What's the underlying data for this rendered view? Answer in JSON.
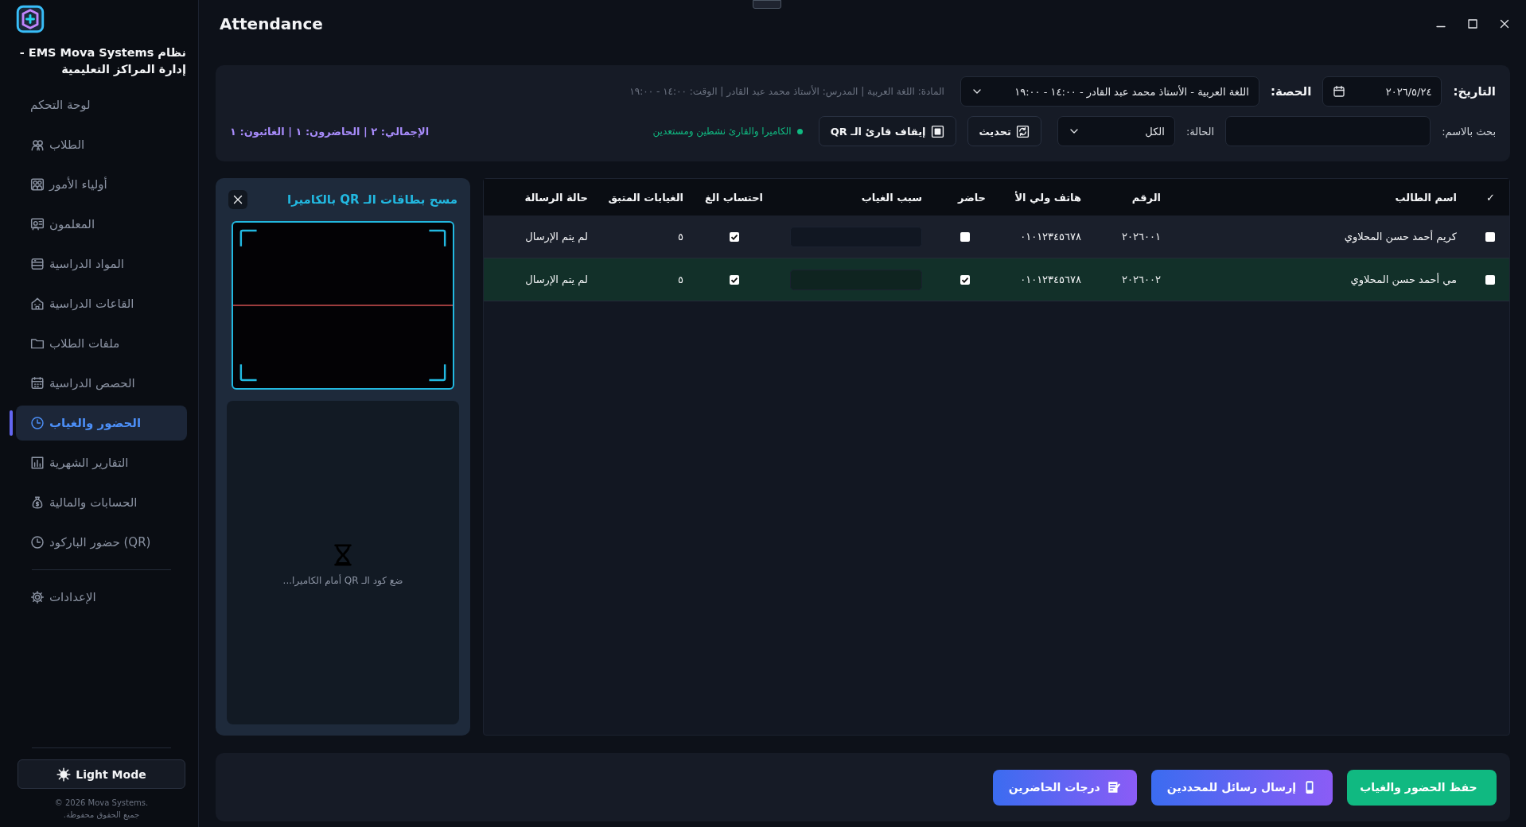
{
  "window": {
    "title": "Attendance"
  },
  "sidebar": {
    "title": "نظام EMS Mova Systems - إدارة المراكز التعليمية",
    "items": [
      {
        "label": "لوحة التحكم",
        "selected": false
      },
      {
        "label": "الطلاب",
        "selected": false
      },
      {
        "label": "أولياء الأمور",
        "selected": false
      },
      {
        "label": "المعلمون",
        "selected": false
      },
      {
        "label": "المواد الدراسية",
        "selected": false
      },
      {
        "label": "القاعات الدراسية",
        "selected": false
      },
      {
        "label": "ملفات الطلاب",
        "selected": false
      },
      {
        "label": "الحصص الدراسية",
        "selected": false
      },
      {
        "label": "الحضور والغياب",
        "selected": true
      },
      {
        "label": "التقارير الشهرية",
        "selected": false
      },
      {
        "label": "الحسابات والمالية",
        "selected": false
      },
      {
        "label": "حضور الباركود (QR)",
        "selected": false
      }
    ],
    "settings": {
      "label": "الإعدادات",
      "selected": false
    },
    "theme_button": "Light Mode",
    "copyright": "© 2026 Mova Systems.",
    "rights": "جميع الحقوق محفوظة."
  },
  "filters": {
    "date_label": "التاريخ:",
    "date": "٢٠٢٦/٥/٢٤",
    "session_label": "الحصة:",
    "session": "اللغة العربية - الأستاذ محمد عبد القادر - ١٤:٠٠ - ١٩:٠٠",
    "session_info": "المادة: اللغة العربية | المدرس: الأستاذ محمد عبد القادر | الوقت: ١٤:٠٠ - ١٩:٠٠",
    "search_label": "بحث بالاسم:",
    "status_label": "الحالة:",
    "status": "الكل",
    "refresh_button": "تحديث",
    "stop_qr_button": "إيقاف قارئ الـ QR",
    "camera_status": "الكاميرا والقارئ نشطين ومستعدين",
    "camera_active": true,
    "totals": "الإجمالي: ٢ | الحاضرون: ١ | الغائبون: ١"
  },
  "scanner": {
    "title": "مسح بطاقات الـ QR بالكاميرا",
    "hint": "ضع كود الـ QR أمام الكاميرا..."
  },
  "table": {
    "columns": [
      "✓",
      "اسم الطالب",
      "الرقم",
      "هاتف ولي الأ",
      "حاضر",
      "سبب الغياب",
      "احتساب الغ",
      "الغيابات المتبق",
      "حالة الرسالة"
    ],
    "rows": [
      {
        "selected": false,
        "name": "كريم أحمد حسن المحلاوي",
        "number": "٢٠٢٦٠٠١",
        "phone": "٠١٠١٢٣٤٥٦٧٨",
        "present": false,
        "count_absence": true,
        "remaining": "٥",
        "message_status": "لم يتم الإرسال"
      },
      {
        "selected": false,
        "name": "مي أحمد حسن المحلاوي",
        "number": "٢٠٢٦٠٠٢",
        "phone": "٠١٠١٢٣٤٥٦٧٨",
        "present": true,
        "count_absence": true,
        "remaining": "٥",
        "message_status": "لم يتم الإرسال"
      }
    ]
  },
  "actions": [
    {
      "label": "حفظ الحضور والغياب",
      "kind": "save"
    },
    {
      "label": "إرسال رسائل للمحددين",
      "kind": "send"
    },
    {
      "label": "درجات الحاضرين",
      "kind": "grades"
    }
  ]
}
